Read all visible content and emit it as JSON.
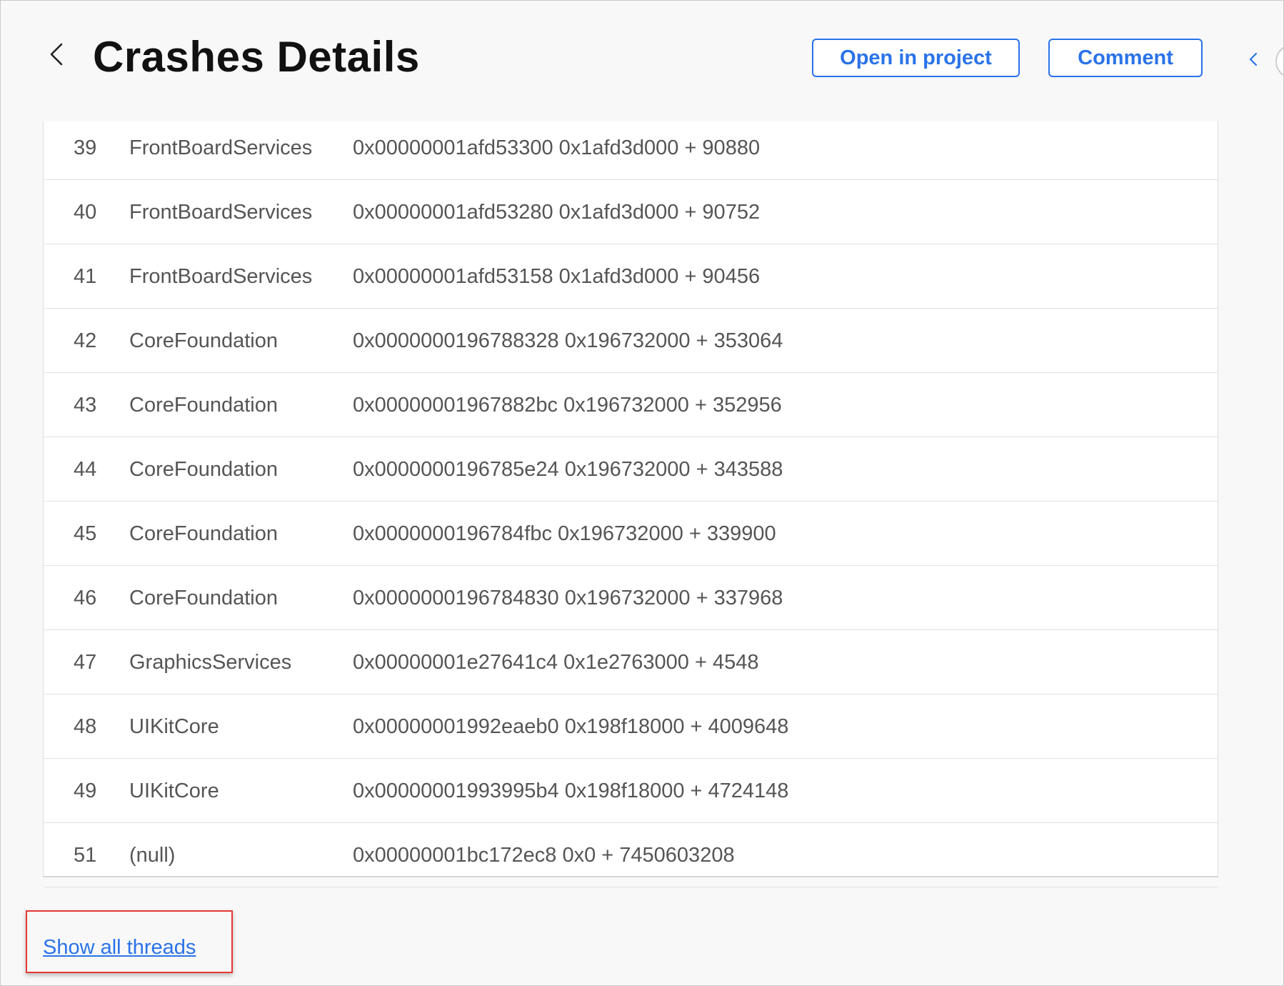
{
  "header": {
    "title": "Crashes Details",
    "open_in_project_label": "Open in project",
    "comment_label": "Comment",
    "back_icon": "chevron-left-icon",
    "prev_icon": "chevron-left-icon"
  },
  "colors": {
    "accent": "#2a73e8",
    "highlight": "#e53935",
    "text_muted": "#555555"
  },
  "rows": [
    {
      "num": "39",
      "lib": "FrontBoardServices",
      "addr": "0x00000001afd53300 0x1afd3d000 + 90880"
    },
    {
      "num": "40",
      "lib": "FrontBoardServices",
      "addr": "0x00000001afd53280 0x1afd3d000 + 90752"
    },
    {
      "num": "41",
      "lib": "FrontBoardServices",
      "addr": "0x00000001afd53158 0x1afd3d000 + 90456"
    },
    {
      "num": "42",
      "lib": "CoreFoundation",
      "addr": "0x0000000196788328 0x196732000 + 353064"
    },
    {
      "num": "43",
      "lib": "CoreFoundation",
      "addr": "0x00000001967882bc 0x196732000 + 352956"
    },
    {
      "num": "44",
      "lib": "CoreFoundation",
      "addr": "0x0000000196785e24 0x196732000 + 343588"
    },
    {
      "num": "45",
      "lib": "CoreFoundation",
      "addr": "0x0000000196784fbc 0x196732000 + 339900"
    },
    {
      "num": "46",
      "lib": "CoreFoundation",
      "addr": "0x0000000196784830 0x196732000 + 337968"
    },
    {
      "num": "47",
      "lib": "GraphicsServices",
      "addr": "0x00000001e27641c4 0x1e2763000 + 4548"
    },
    {
      "num": "48",
      "lib": "UIKitCore",
      "addr": "0x00000001992eaeb0 0x198f18000 + 4009648"
    },
    {
      "num": "49",
      "lib": "UIKitCore",
      "addr": "0x00000001993995b4 0x198f18000 + 4724148"
    },
    {
      "num": "51",
      "lib": "(null)",
      "addr": "0x00000001bc172ec8 0x0 + 7450603208"
    }
  ],
  "footer": {
    "show_all_threads_label": "Show all threads"
  }
}
